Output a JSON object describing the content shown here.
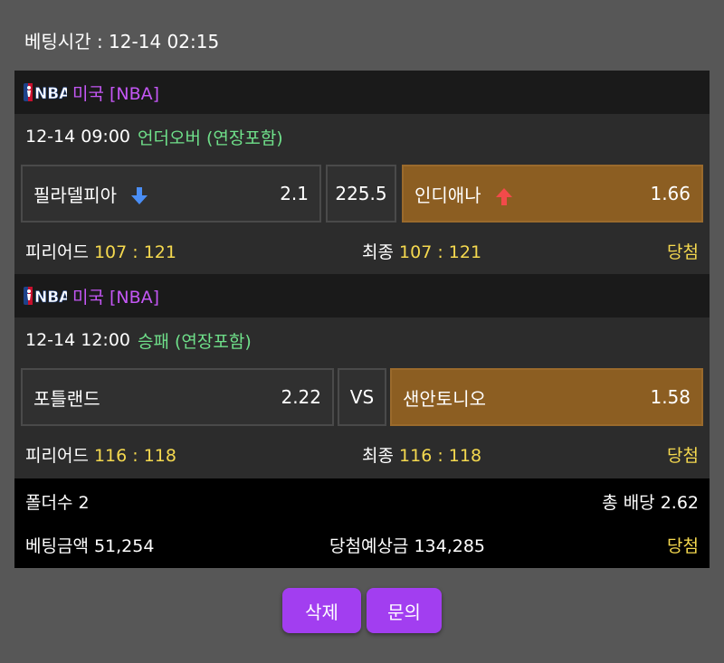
{
  "header": {
    "bet_time": "베팅시간 : 12-14 02:15"
  },
  "bets": [
    {
      "league": "미국 [NBA]",
      "match_time": "12-14 09:00",
      "match_type": "언더오버 (연장포함)",
      "home": {
        "name": "필라델피아",
        "odds": "2.1",
        "icon": "arrow-down-icon"
      },
      "center": "225.5",
      "away": {
        "name": "인디애나",
        "odds": "1.66",
        "icon": "arrow-up-icon"
      },
      "selected": "away",
      "period_label": "피리어드",
      "period_score": "107 : 121",
      "final_label": "최종",
      "final_score": "107 : 121",
      "result": "당첨"
    },
    {
      "league": "미국 [NBA]",
      "match_time": "12-14 12:00",
      "match_type": "승패 (연장포함)",
      "home": {
        "name": "포틀랜드",
        "odds": "2.22"
      },
      "center": "VS",
      "away": {
        "name": "샌안토니오",
        "odds": "1.58"
      },
      "selected": "away",
      "period_label": "피리어드",
      "period_score": "116 : 118",
      "final_label": "최종",
      "final_score": "116 : 118",
      "result": "당첨"
    }
  ],
  "summary": {
    "folder_count": "폴더수 2",
    "total_odds": "총 배당 2.62",
    "bet_amount": "베팅금액 51,254",
    "expected_win": "당첨예상금 134,285",
    "result": "당첨"
  },
  "buttons": {
    "delete": "삭제",
    "inquiry": "문의"
  },
  "colors": {
    "league": "#c457f5",
    "match_type": "#6fe08a",
    "score": "#f5d94f",
    "selected": "#8c5e22",
    "button": "#a23ef0",
    "arrow_down": "#4a8ef5",
    "arrow_up": "#f24a4a"
  }
}
